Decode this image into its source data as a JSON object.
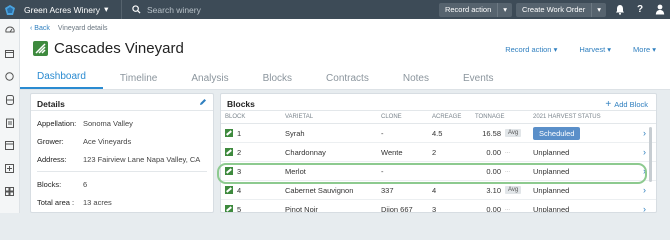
{
  "topbar": {
    "winery_name": "Green Acres Winery",
    "search_placeholder": "Search winery",
    "record_action": "Record action",
    "create_work_order": "Create Work Order"
  },
  "breadcrumb": {
    "back": "Back",
    "current": "Vineyard details"
  },
  "page": {
    "title": "Cascades Vineyard",
    "actions": [
      "Record action",
      "Harvest",
      "More"
    ]
  },
  "tabs": [
    "Dashboard",
    "Timeline",
    "Analysis",
    "Blocks",
    "Contracts",
    "Notes",
    "Events"
  ],
  "details": {
    "title": "Details",
    "rows": [
      {
        "key": "Appellation:",
        "value": "Sonoma Valley"
      },
      {
        "key": "Grower:",
        "value": "Ace Vineyards"
      },
      {
        "key": "Address:",
        "value": "123 Fairview Lane Napa Valley, CA"
      },
      {
        "key": "Blocks:",
        "value": "6"
      },
      {
        "key": "Total area :",
        "value": "13 acres"
      }
    ]
  },
  "blocks": {
    "title": "Blocks",
    "add_label": "Add Block",
    "headers": [
      "Block",
      "Varietal",
      "Clone",
      "Acreage",
      "Tonnage",
      "2021 Harvest Status"
    ],
    "avg_label": "Avg",
    "rows": [
      {
        "block": "1",
        "varietal": "Syrah",
        "clone": "-",
        "acreage": "4.5",
        "tonnage": "16.58",
        "avg": true,
        "status": "Scheduled"
      },
      {
        "block": "2",
        "varietal": "Chardonnay",
        "clone": "Wente",
        "acreage": "2",
        "tonnage": "0.00",
        "avg": false,
        "status": "Unplanned"
      },
      {
        "block": "3",
        "varietal": "Merlot",
        "clone": "-",
        "acreage": "",
        "tonnage": "0.00",
        "avg": false,
        "status": "Unplanned"
      },
      {
        "block": "4",
        "varietal": "Cabernet Sauvignon",
        "clone": "337",
        "acreage": "4",
        "tonnage": "3.10",
        "avg": true,
        "status": "Unplanned"
      },
      {
        "block": "5",
        "varietal": "Pinot Noir",
        "clone": "Dijon 667",
        "acreage": "3",
        "tonnage": "0.00",
        "avg": false,
        "status": "Unplanned"
      }
    ]
  },
  "colors": {
    "accent": "#2a8bd1",
    "topbar": "#3d4b57",
    "scheduled": "#5a8fc9",
    "highlight": "#8dca8f"
  }
}
